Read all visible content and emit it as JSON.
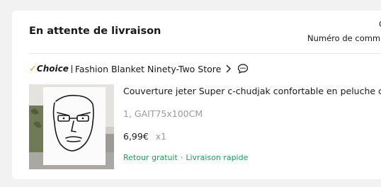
{
  "order": {
    "status": "En attente de livraison",
    "date_fragment": "C",
    "number_label": "Numéro de comm"
  },
  "store": {
    "choice_check": "✓",
    "choice_label": "Choice",
    "name": "Fashion Blanket Ninety-Two Store"
  },
  "item": {
    "title": "Couverture jeter Super c-chudjak confortable en peluche c",
    "variant": "1, GAIT75x100CM",
    "price": "6,99€",
    "quantity": "x1",
    "benefit_1": "Retour gratuit",
    "benefit_sep": "·",
    "benefit_2": "Livraison rapide"
  },
  "colors": {
    "choice_check": "#f5a300",
    "benefits_green": "#1b9e52",
    "muted_gray": "#9a9a9a"
  },
  "icons": [
    "chevron-right-icon",
    "chat-bubble-icon"
  ]
}
